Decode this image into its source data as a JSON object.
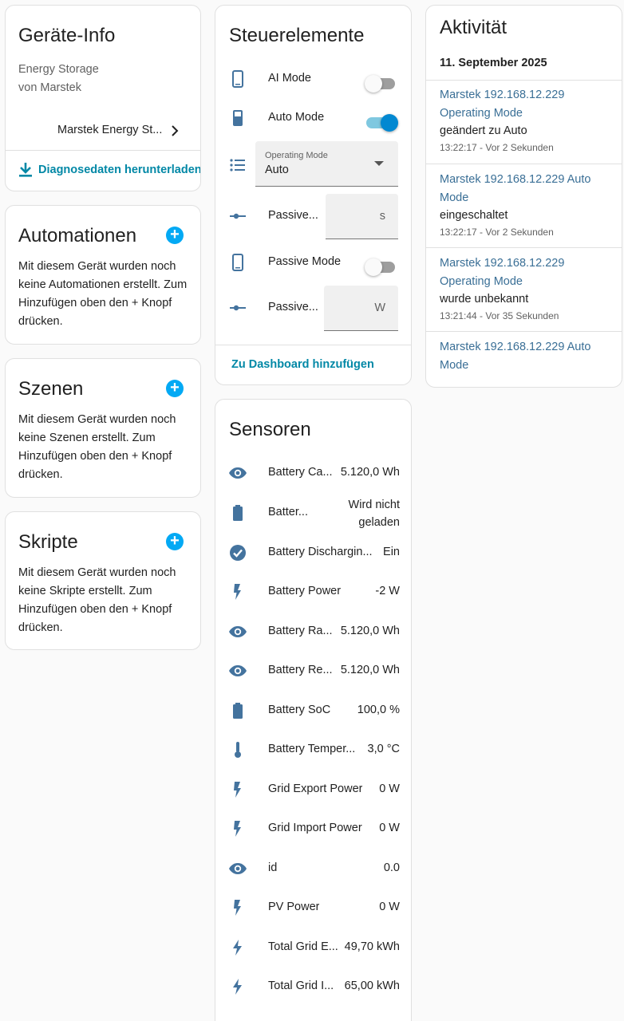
{
  "colors": {
    "accent": "#03a9f4",
    "icon": "#44739e",
    "link": "#0288a6",
    "activity_link": "#3a6f96"
  },
  "device_info": {
    "title": "Geräte-Info",
    "model": "Energy Storage",
    "manufacturer": "von Marstek",
    "device_link": "Marstek Energy St...",
    "download_label": "Diagnosedaten herunterladen"
  },
  "automations": {
    "title": "Automationen",
    "text": "Mit diesem Gerät wurden noch keine Automationen erstellt. Zum Hinzufügen oben den + Knopf drücken."
  },
  "scenes": {
    "title": "Szenen",
    "text": "Mit diesem Gerät wurden noch keine Szenen erstellt. Zum Hinzufügen oben den + Knopf drücken."
  },
  "scripts": {
    "title": "Skripte",
    "text": "Mit diesem Gerät wurden noch keine Skripte erstellt. Zum Hinzufügen oben den + Knopf drücken."
  },
  "controls": {
    "title": "Steuerelemente",
    "ai_mode": {
      "label": "AI Mode",
      "state": "off"
    },
    "auto_mode": {
      "label": "Auto Mode",
      "state": "on"
    },
    "operating_mode": {
      "label": "Operating Mode",
      "value": "Auto"
    },
    "passive_1": {
      "label": "Passive...",
      "unit": "s"
    },
    "passive_mode": {
      "label": "Passive Mode",
      "state": "off"
    },
    "passive_2": {
      "label": "Passive...",
      "unit": "W"
    },
    "add_dashboard": "Zu Dashboard hinzufügen"
  },
  "sensors": {
    "title": "Sensoren",
    "items": [
      {
        "icon": "eye-icon",
        "label": "Battery Ca...",
        "value": "5.120,0 Wh"
      },
      {
        "icon": "battery-icon",
        "label": "Batter...",
        "value": "Wird nicht",
        "value2": "geladen"
      },
      {
        "icon": "check-circle-icon",
        "label": "Battery Dischargin...",
        "value": "Ein"
      },
      {
        "icon": "flash-icon",
        "label": "Battery Power",
        "value": "-2 W"
      },
      {
        "icon": "eye-icon",
        "label": "Battery Ra...",
        "value": "5.120,0 Wh"
      },
      {
        "icon": "eye-icon",
        "label": "Battery Re...",
        "value": "5.120,0 Wh"
      },
      {
        "icon": "battery-icon",
        "label": "Battery SoC",
        "value": "100,0 %"
      },
      {
        "icon": "thermometer-icon",
        "label": "Battery Temper...",
        "value": "3,0 °C"
      },
      {
        "icon": "flash-icon",
        "label": "Grid Export Power",
        "value": "0 W"
      },
      {
        "icon": "flash-icon",
        "label": "Grid Import Power",
        "value": "0 W"
      },
      {
        "icon": "eye-icon",
        "label": "id",
        "value": "0.0"
      },
      {
        "icon": "flash-icon",
        "label": "PV Power",
        "value": "0 W"
      },
      {
        "icon": "lightning-icon",
        "label": "Total Grid E...",
        "value": "49,70 kWh"
      },
      {
        "icon": "lightning-icon",
        "label": "Total Grid I...",
        "value": "65,00 kWh"
      }
    ]
  },
  "activity": {
    "title": "Aktivität",
    "date": "11. September 2025",
    "entries": [
      {
        "link1": "Marstek 192.168.12.229",
        "link2": "Operating Mode",
        "text": "geändert zu Auto",
        "time": "13:22:17 - Vor 2 Sekunden"
      },
      {
        "link1": "Marstek 192.168.12.229 Auto",
        "link2": "Mode",
        "text": "eingeschaltet",
        "time": "13:22:17 - Vor 2 Sekunden"
      },
      {
        "link1": "Marstek 192.168.12.229",
        "link2": "Operating Mode",
        "text": "wurde unbekannt",
        "time": "13:21:44 - Vor 35 Sekunden"
      },
      {
        "link1": "Marstek 192.168.12.229 Auto",
        "link2": "Mode",
        "text": "",
        "time": ""
      }
    ]
  }
}
